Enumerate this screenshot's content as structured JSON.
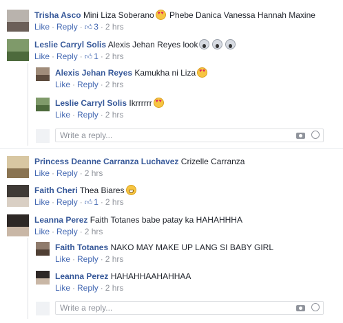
{
  "actions": {
    "like": "Like",
    "reply": "Reply",
    "sep": "·"
  },
  "threads": [
    {
      "author": "Trisha Asco",
      "text_before": "Mini Liza Soberano",
      "emoji_mid": "heart-eyes",
      "text_after": "Phebe Danica Vanessa Hannah Maxine",
      "likes": "3",
      "time": "2 hrs"
    },
    {
      "author": "Leslie Carryl Solis",
      "text": "Alexis Jehan Reyes look",
      "emoji": [
        "scream",
        "scream",
        "scream"
      ],
      "likes": "1",
      "time": "2 hrs",
      "replies": [
        {
          "author": "Alexis Jehan Reyes",
          "text": "Kamukha ni Liza",
          "emoji": "heart-eyes",
          "time": "2 hrs"
        },
        {
          "author": "Leslie Carryl Solis",
          "text": "Ikrrrrrr",
          "emoji": "heart-eyes",
          "time": "2 hrs"
        }
      ],
      "reply_placeholder": "Write a reply..."
    },
    {
      "author": "Princess Deanne Carranza Luchavez",
      "text": "Crizelle Carranza",
      "time": "2 hrs"
    },
    {
      "author": "Faith Cheri",
      "text": "Thea Biares",
      "emoji": "grin",
      "likes": "1",
      "time": "2 hrs"
    },
    {
      "author": "Leanna Perez",
      "text": "Faith Totanes babe patay ka HAHAHHHA",
      "time": "2 hrs",
      "replies": [
        {
          "author": "Faith Totanes",
          "text": "NAKO MAY MAKE UP LANG SI BABY GIRL",
          "time": "2 hrs"
        },
        {
          "author": "Leanna Perez",
          "text": "HAHAHHAAHAHHAA",
          "time": "2 hrs"
        }
      ],
      "reply_placeholder": "Write a reply..."
    }
  ],
  "icons": {
    "camera": "camera-icon",
    "smiley": "smiley-icon",
    "thumb": "thumbs-up-icon"
  }
}
